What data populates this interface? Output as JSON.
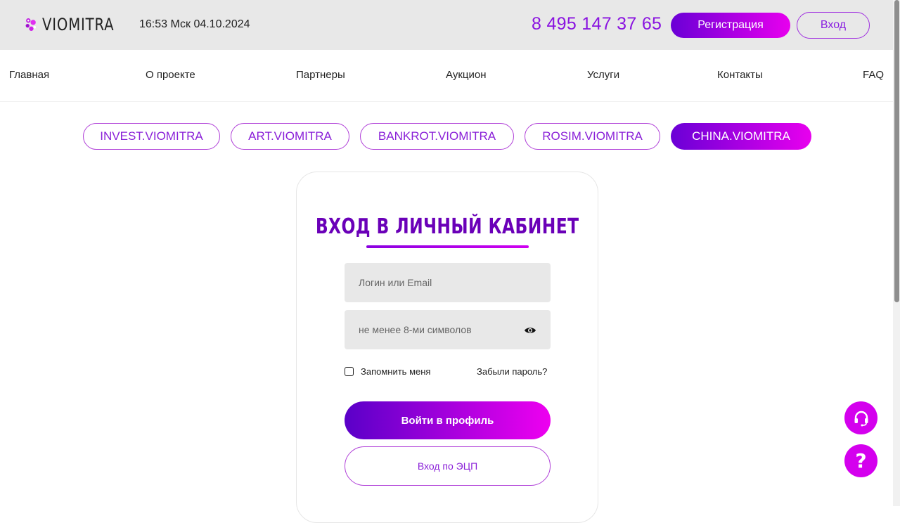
{
  "header": {
    "logo_text": "VIOMITRA",
    "datetime": "16:53 Мск 04.10.2024",
    "phone": "8 495 147 37 65",
    "register_label": "Регистрация",
    "login_label": "Вход"
  },
  "nav": {
    "items": [
      {
        "label": "Главная"
      },
      {
        "label": "О проекте"
      },
      {
        "label": "Партнеры"
      },
      {
        "label": "Аукцион"
      },
      {
        "label": "Услуги"
      },
      {
        "label": "Контакты"
      },
      {
        "label": "FAQ"
      }
    ]
  },
  "tabs": [
    {
      "label": "INVEST.VIOMITRA",
      "active": false
    },
    {
      "label": "ART.VIOMITRA",
      "active": false
    },
    {
      "label": "BANKROT.VIOMITRA",
      "active": false
    },
    {
      "label": "ROSIM.VIOMITRA",
      "active": false
    },
    {
      "label": "CHINA.VIOMITRA",
      "active": true
    }
  ],
  "login_card": {
    "title": "ВХОД В ЛИЧНЫЙ КАБИНЕТ",
    "login_placeholder": "Логин или Email",
    "password_placeholder": "не менее 8-ми символов",
    "remember_label": "Запомнить меня",
    "forgot_label": "Забыли пароль?",
    "submit_label": "Войти в профиль",
    "ecp_label": "Вход по ЭЦП"
  },
  "fab": {
    "help_label": "?"
  },
  "colors": {
    "accent": "#8a14e0",
    "gradient_start": "#6a00d6",
    "gradient_end": "#e800ee",
    "fab": "#d400ee",
    "title": "#6a00b8"
  }
}
